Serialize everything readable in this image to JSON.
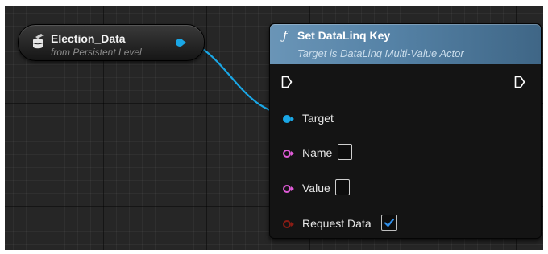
{
  "variable_node": {
    "title": "Election_Data",
    "subtitle": "from Persistent Level",
    "icon": "database-variable-icon"
  },
  "function_node": {
    "icon_glyph": "ƒ",
    "title": "Set DataLinq Key",
    "subtitle": "Target is DataLinq Multi-Value Actor",
    "pins": {
      "target": {
        "label": "Target",
        "color": "#1aa7e6"
      },
      "name": {
        "label": "Name",
        "color": "#e05bd8"
      },
      "value": {
        "label": "Value",
        "color": "#e05bd8"
      },
      "request_data": {
        "label": "Request Data",
        "color": "#8a1c14",
        "checked": true
      }
    }
  },
  "colors": {
    "graph_background": "#262626",
    "header_accent": "#5582a6",
    "wire": "#1aa7e6",
    "check": "#2f8ee8"
  }
}
